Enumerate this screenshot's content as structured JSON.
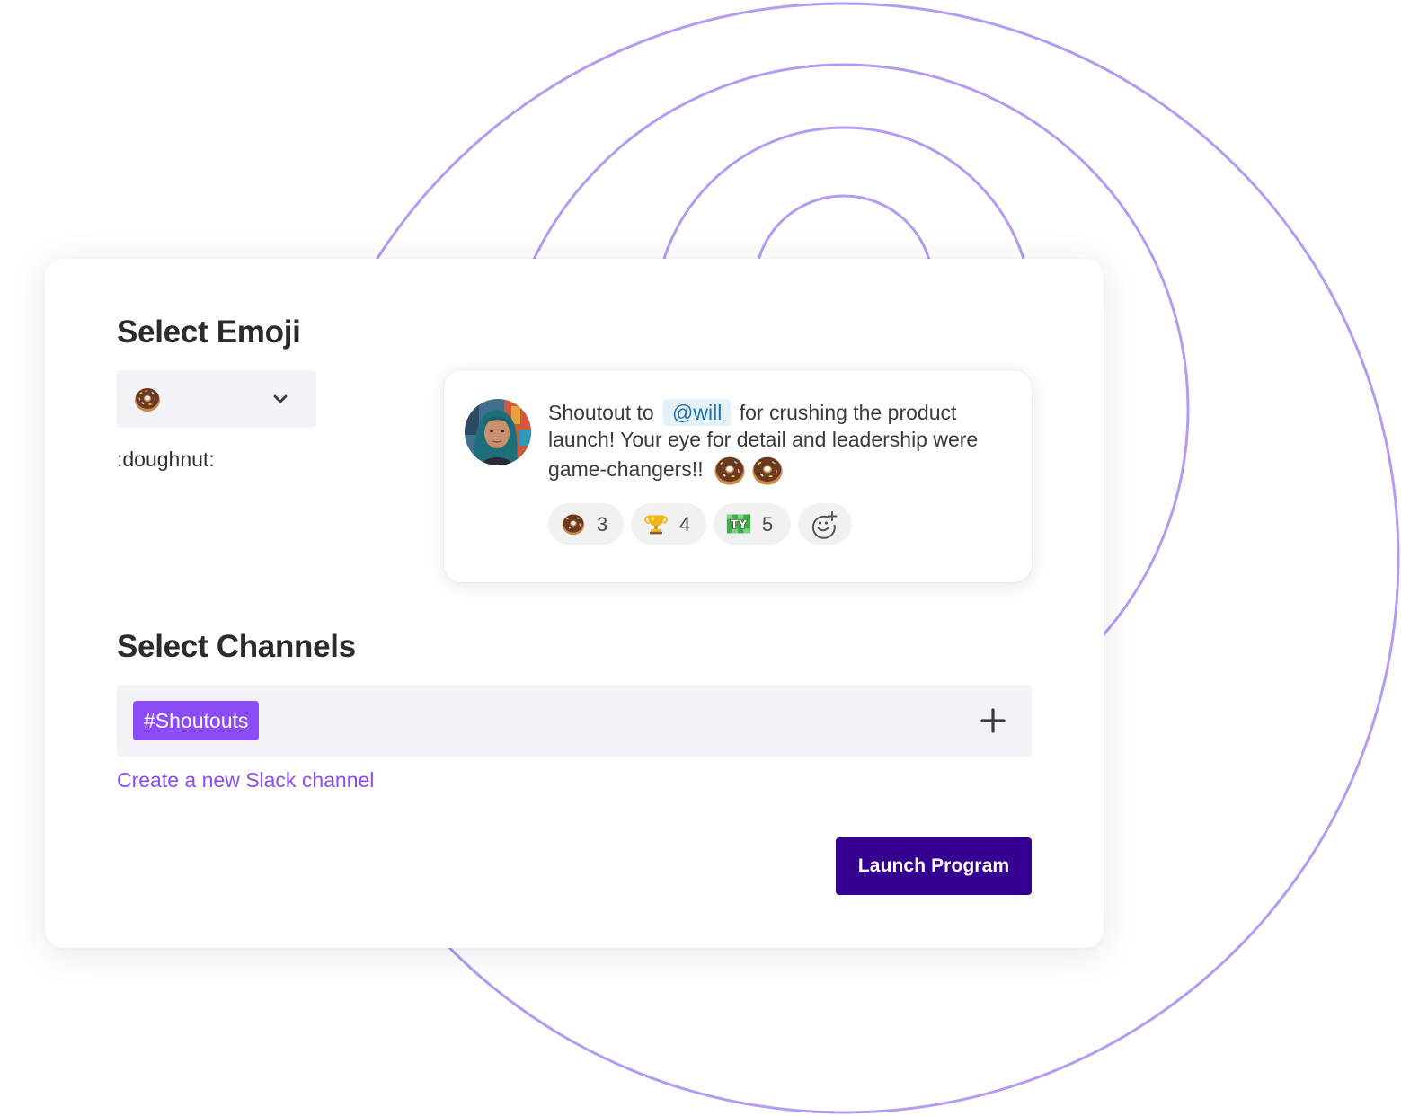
{
  "theme": {
    "accent": "#8b4cf7",
    "button": "#35008f",
    "ring": "#b59af3",
    "field_bg": "#f3f2f7",
    "mention_bg": "#e5f1fa",
    "mention_text": "#1d6fa8"
  },
  "emoji_section": {
    "title": "Select Emoji",
    "selected_icon": "doughnut-icon",
    "dropdown_icon": "chevron-down-icon",
    "shortcode": ":doughnut:"
  },
  "preview_message": {
    "avatar": "user-avatar-photo",
    "text_before": "Shoutout to",
    "mention": "@will",
    "text_after": "for crushing the product launch! Your eye for detail and leadership were game-changers!!",
    "trailing_emojis": [
      "doughnut-icon",
      "doughnut-icon"
    ],
    "reactions": [
      {
        "icon": "doughnut-icon",
        "count": "3"
      },
      {
        "icon": "trophy-icon",
        "count": "4"
      },
      {
        "icon": "ty-icon",
        "count": "5"
      }
    ],
    "add_reaction_icon": "add-reaction-icon"
  },
  "channels_section": {
    "title": "Select Channels",
    "selected_channels": [
      "#Shoutouts"
    ],
    "add_icon": "plus-icon",
    "create_link": "Create a new Slack channel"
  },
  "actions": {
    "launch_label": "Launch Program"
  }
}
